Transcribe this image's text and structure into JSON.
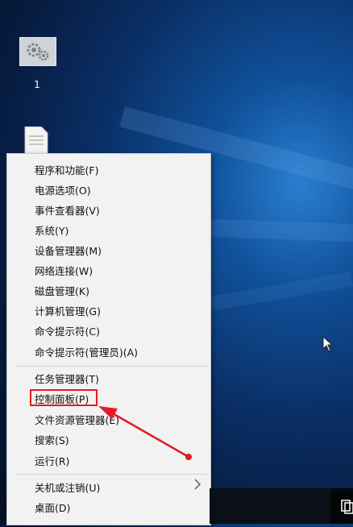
{
  "desktop": {
    "icon1_label": "1"
  },
  "menu": {
    "items": [
      {
        "label": "程序和功能(F)"
      },
      {
        "label": "电源选项(O)"
      },
      {
        "label": "事件查看器(V)"
      },
      {
        "label": "系统(Y)"
      },
      {
        "label": "设备管理器(M)"
      },
      {
        "label": "网络连接(W)"
      },
      {
        "label": "磁盘管理(K)"
      },
      {
        "label": "计算机管理(G)"
      },
      {
        "label": "命令提示符(C)"
      },
      {
        "label": "命令提示符(管理员)(A)"
      },
      {
        "label": "任务管理器(T)"
      },
      {
        "label": "控制面板(P)"
      },
      {
        "label": "文件资源管理器(E)"
      },
      {
        "label": "搜索(S)"
      },
      {
        "label": "运行(R)"
      },
      {
        "label": "关机或注销(U)"
      },
      {
        "label": "桌面(D)"
      }
    ],
    "highlighted_item": "控制面板(P)"
  },
  "colors": {
    "highlight_box": "#e41b23",
    "annotation_arrow": "#e41b23",
    "menu_bg": "#f2f2f2"
  },
  "icons": [
    "settings-icon",
    "document-icon",
    "chevron-right-icon",
    "mouse-cursor-icon",
    "task-view-icon"
  ]
}
